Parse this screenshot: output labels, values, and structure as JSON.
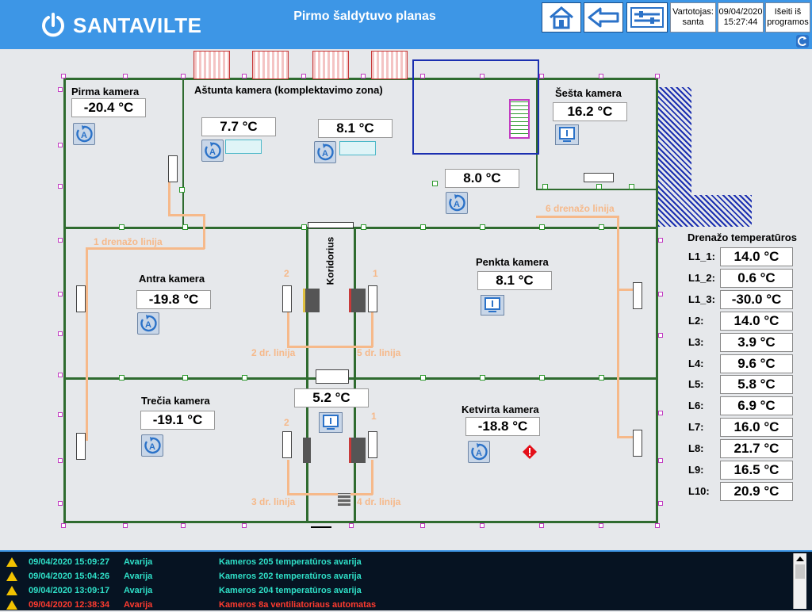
{
  "header": {
    "brand": "SANTAVILTE",
    "title": "Pirmo šaldytuvo planas",
    "user_label": "Vartotojas:",
    "user_name": "santa",
    "date": "09/04/2020",
    "time": "15:27:44",
    "exit_line1": "Išeiti iš",
    "exit_line2": "programos",
    "accent_color": "#3d96e6"
  },
  "rooms": {
    "pirma": {
      "label": "Pirma kamera",
      "temp": "-20.4 °C"
    },
    "astunta": {
      "label": "Aštunta kamera (komplektavimo zona)",
      "temp1": "7.7 °C",
      "temp2": "8.1 °C",
      "temp3": "8.0 °C"
    },
    "sesta": {
      "label": "Šešta kamera",
      "temp": "16.2 °C"
    },
    "antra": {
      "label": "Antra kamera",
      "temp": "-19.8 °C"
    },
    "penkta": {
      "label": "Penkta kamera",
      "temp": "8.1 °C"
    },
    "trecia": {
      "label": "Trečia kamera",
      "temp": "-19.1 °C"
    },
    "ketvirta": {
      "label": "Ketvirta kamera",
      "temp": "-18.8 °C"
    },
    "koridorius": {
      "label": "Koridorius",
      "temp": "5.2 °C"
    }
  },
  "drain_lines": {
    "l1": "1 drenažo linija",
    "l6": "6 drenažo linija",
    "l2": "2 dr. linija",
    "l5": "5 dr. linija",
    "l3": "3 dr. linija",
    "l4": "4 dr. linija",
    "n2a": "2",
    "n1a": "1",
    "n2b": "2",
    "n1b": "1"
  },
  "drain_temps": {
    "title": "Drenažo temperatūros",
    "rows": [
      {
        "label": "L1_1:",
        "value": "14.0 °C"
      },
      {
        "label": "L1_2:",
        "value": "0.6 °C"
      },
      {
        "label": "L1_3:",
        "value": "-30.0 °C"
      },
      {
        "label": "L2:",
        "value": "14.0 °C"
      },
      {
        "label": "L3:",
        "value": "3.9 °C"
      },
      {
        "label": "L4:",
        "value": "9.6 °C"
      },
      {
        "label": "L5:",
        "value": "5.8 °C"
      },
      {
        "label": "L6:",
        "value": "6.9 °C"
      },
      {
        "label": "L7:",
        "value": "16.0 °C"
      },
      {
        "label": "L8:",
        "value": "21.7 °C"
      },
      {
        "label": "L9:",
        "value": "16.5 °C"
      },
      {
        "label": "L10:",
        "value": "20.9 °C"
      }
    ]
  },
  "alarms": [
    {
      "date": "09/04/2020 15:09:27",
      "type": "Avarija",
      "message": "Kameros 205 temperatūros avarija",
      "color": "#2fe0c8"
    },
    {
      "date": "09/04/2020 15:04:26",
      "type": "Avarija",
      "message": "Kameros 202 temperatūros avarija",
      "color": "#2fe0c8"
    },
    {
      "date": "09/04/2020 13:09:17",
      "type": "Avarija",
      "message": "Kameros 204 temperatūros avarija",
      "color": "#2fe0c8"
    },
    {
      "date": "09/04/2020 12:38:34",
      "type": "Avarija",
      "message": "Kameros 8a ventiliatoriaus automatas",
      "color": "#ff3b2f"
    }
  ]
}
